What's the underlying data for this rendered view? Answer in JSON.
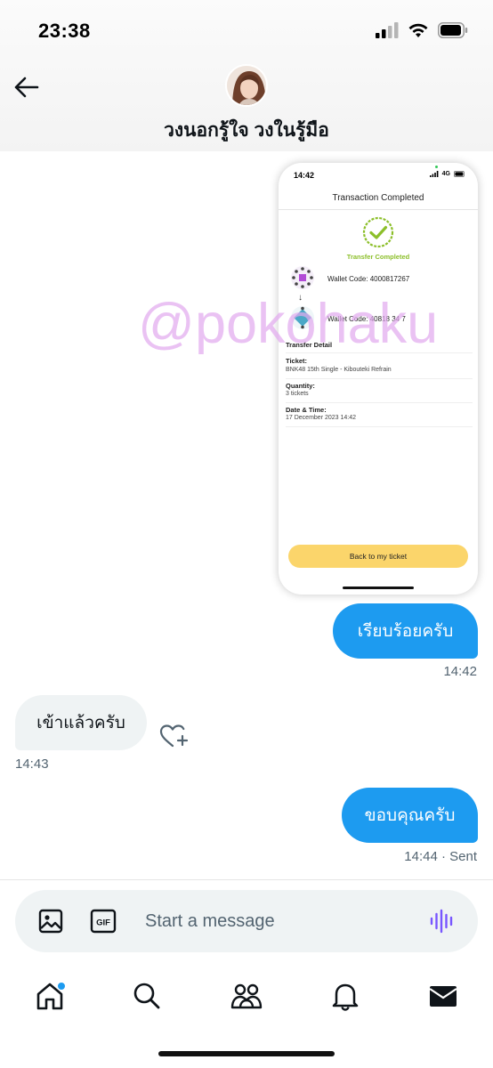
{
  "status_bar": {
    "time": "23:38"
  },
  "header": {
    "back_icon": "arrow-left-icon",
    "title": "วงนอกรู้ใจ วงในรู้มือ",
    "avatar": "profile-avatar"
  },
  "attachment": {
    "status_time": "14:42",
    "status_network": "4G",
    "title": "Transaction Completed",
    "completed_label": "Transfer Completed",
    "wallet_from": "Wallet Code: 4000817267",
    "wallet_to": "Wallet Code: 40818  34 7",
    "section_title": "Transfer Detail",
    "ticket_label": "Ticket:",
    "ticket_value": "BNK48 15th Single - Kibouteki Refrain",
    "quantity_label": "Quantity:",
    "quantity_value": "3 tickets",
    "datetime_label": "Date & Time:",
    "datetime_value": "17 December 2023 14:42",
    "button_label": "Back to my ticket",
    "watermark": "@pokohaku"
  },
  "messages": [
    {
      "direction": "sent",
      "text": "เรียบร้อยครับ",
      "timestamp": "14:42"
    },
    {
      "direction": "received",
      "text": "เข้าแล้วครับ",
      "timestamp": "14:43"
    },
    {
      "direction": "sent",
      "text": "ขอบคุณครับ",
      "timestamp": "14:44 · Sent"
    }
  ],
  "composer": {
    "placeholder": "Start a message",
    "media_icon": "image-icon",
    "gif_icon": "gif-icon",
    "voice_icon": "voice-icon"
  },
  "nav": {
    "items": [
      "home",
      "search",
      "communities",
      "notifications",
      "messages"
    ],
    "active": "messages",
    "notification_dot_on": "home"
  },
  "colors": {
    "accent": "#1d9bf0",
    "incoming_bubble": "#eff3f4",
    "voice_icon": "#7856ff",
    "watermark": "#e2aaee",
    "success_green": "#8cbf2a",
    "ticket_button": "#fbd56b"
  }
}
